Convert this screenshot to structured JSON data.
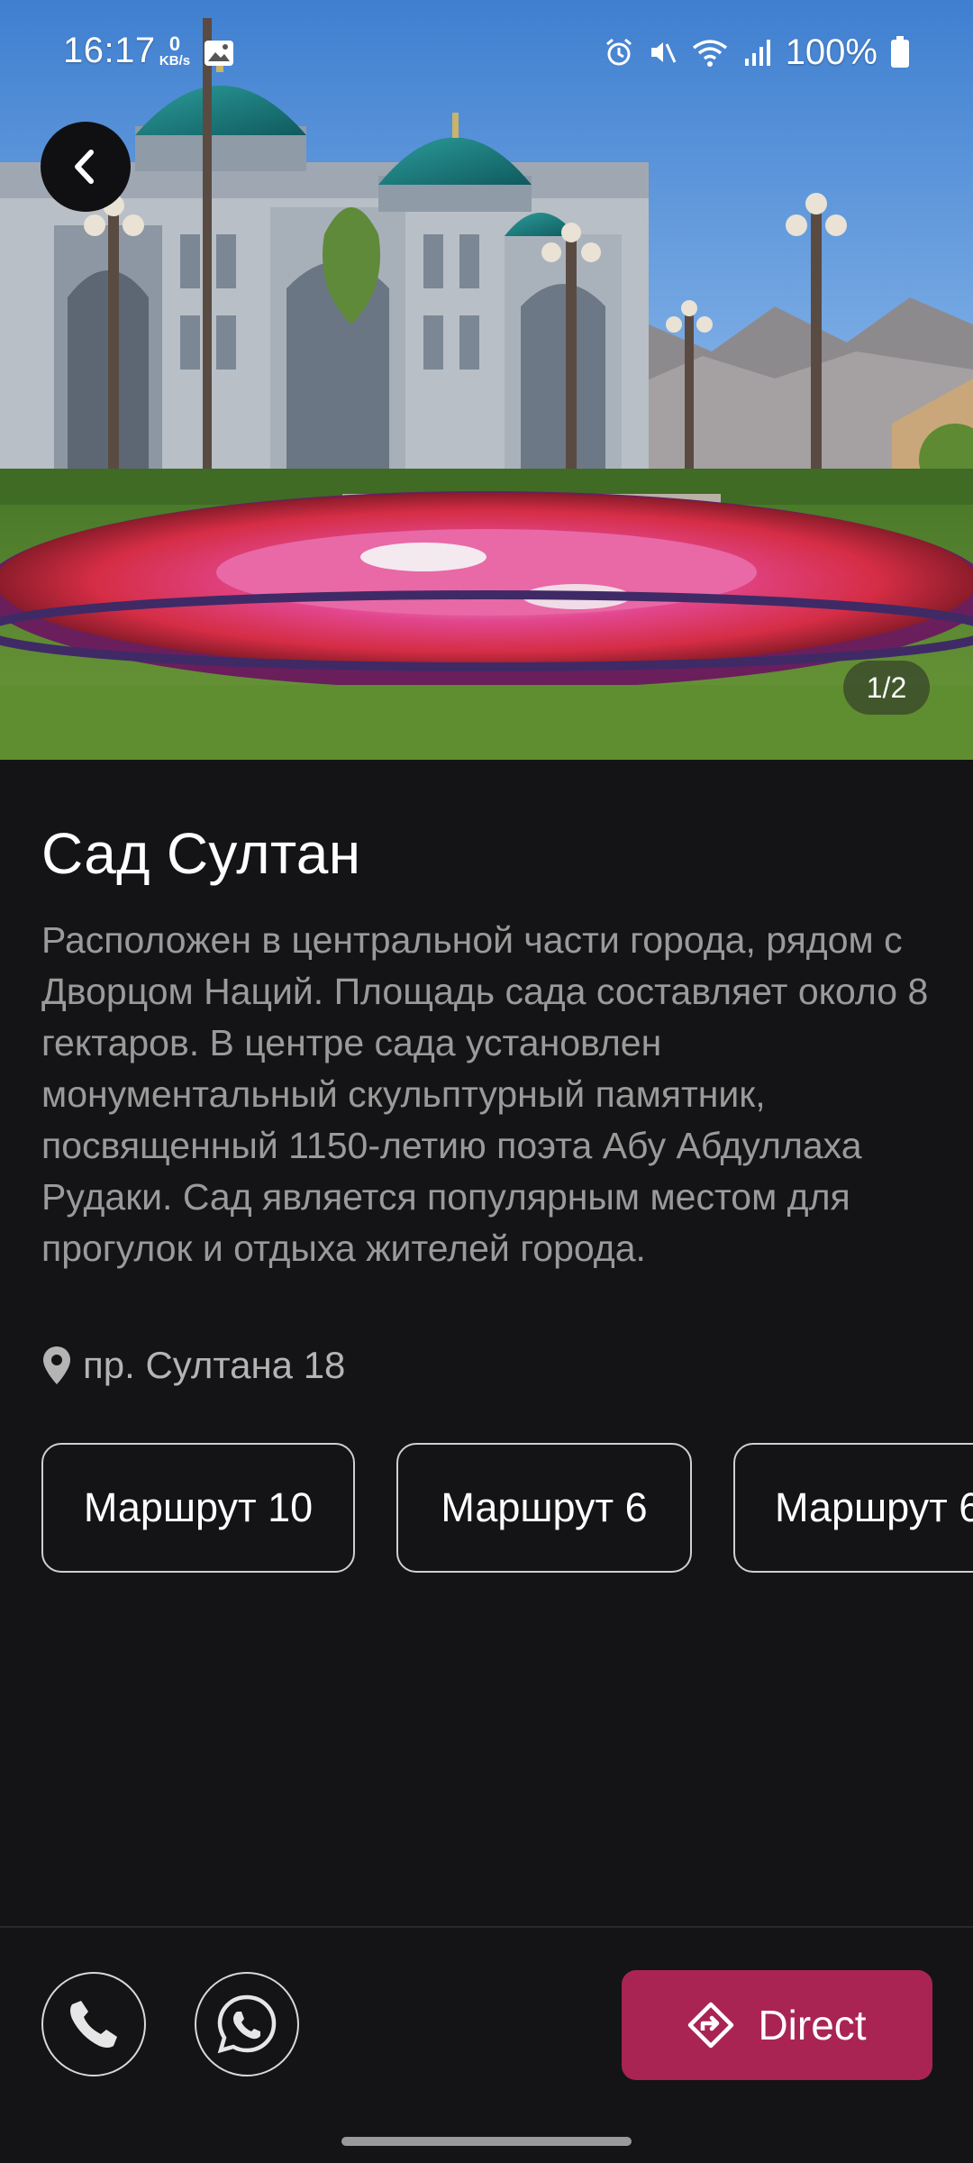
{
  "status_bar": {
    "time": "16:17",
    "net_speed_value": "0",
    "net_speed_unit": "KB/s",
    "battery": "100%",
    "icons": [
      "gallery-icon",
      "alarm-icon",
      "mute-icon",
      "wifi-icon",
      "signal-icon",
      "battery-icon"
    ]
  },
  "gallery": {
    "counter": "1/2"
  },
  "place": {
    "title": "Сад Султан",
    "description": "Расположен в центральной части города, рядом с Дворцом Наций. Площадь сада составляет около 8 гектаров. В центре сада установлен монументальный скульптурный памятник, посвященный 1150-летию поэта Абу Абдуллаха Рудаки. Сад является популярным местом для прогулок и отдыха жителей города.",
    "address": "пр. Султана 18"
  },
  "routes": [
    {
      "label": "Маршрут 10"
    },
    {
      "label": "Маршрут 6"
    },
    {
      "label": "Маршрут 6"
    }
  ],
  "actions": {
    "direct_label": "Direct"
  },
  "colors": {
    "background": "#141416",
    "accent": "#a92453",
    "description_text": "#9a9a9a"
  }
}
